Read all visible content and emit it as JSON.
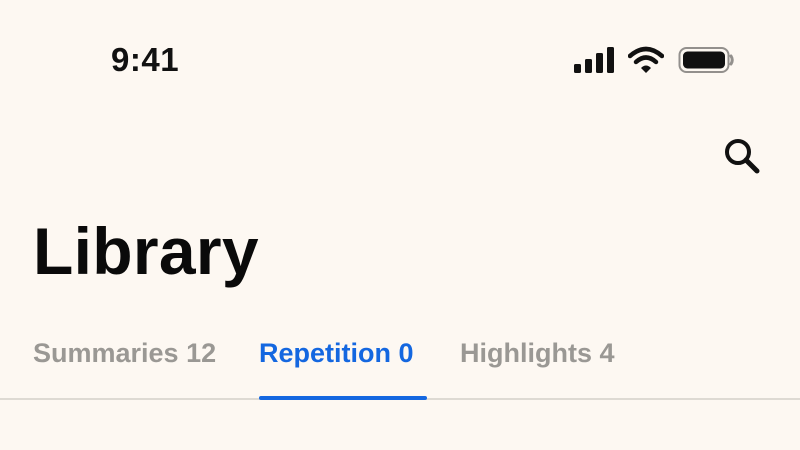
{
  "status_bar": {
    "time": "9:41",
    "icons": [
      "cellular-signal-icon",
      "wifi-icon",
      "battery-icon"
    ]
  },
  "header": {
    "search_icon": "search-icon",
    "title": "Library"
  },
  "tabs": [
    {
      "label": "Summaries",
      "count": "12",
      "active": false
    },
    {
      "label": "Repetition",
      "count": "0",
      "active": true
    },
    {
      "label": "Highlights",
      "count": "4",
      "active": false
    }
  ],
  "colors": {
    "background": "#FDF8F2",
    "accent": "#1467E0",
    "inactive_tab": "#9A9894",
    "title": "#0A0A0A",
    "divider": "#DEDAD3"
  }
}
